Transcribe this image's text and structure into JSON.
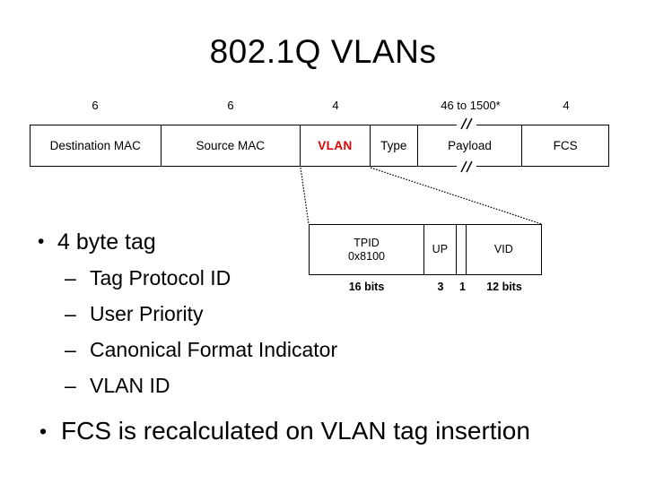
{
  "slide": {
    "title": "802.1Q VLANs"
  },
  "frame": {
    "name": "ethernet-frame",
    "cells": [
      {
        "label": "Destination MAC",
        "size": "6",
        "accent": false
      },
      {
        "label": "Source MAC",
        "size": "6",
        "accent": false
      },
      {
        "label": "VLAN",
        "size": "4",
        "accent": true
      },
      {
        "label": "Type",
        "size": "",
        "accent": false
      },
      {
        "label": "Payload",
        "size": "46 to 1500*",
        "accent": false
      },
      {
        "label": "FCS",
        "size": "4",
        "accent": false
      }
    ]
  },
  "tag": {
    "name": "vlan-tag-detail",
    "cells": [
      {
        "label": "TPID",
        "value": "0x8100",
        "bits": "16 bits"
      },
      {
        "label": "UP",
        "value": "",
        "bits": "3"
      },
      {
        "label": "",
        "value": "",
        "bits": "1"
      },
      {
        "label": "VID",
        "value": "",
        "bits": "12 bits"
      }
    ]
  },
  "bullets": {
    "primary": "4 byte tag",
    "sub_items": [
      "Tag Protocol ID",
      "User Priority",
      "Canonical Format Indicator",
      "VLAN ID"
    ],
    "final": "FCS is recalculated on VLAN tag insertion",
    "bullet_glyph": "•",
    "dash_glyph": "–"
  },
  "colors": {
    "accent_red": "#e00000",
    "text": "#000000",
    "background": "#ffffff",
    "border": "#000000"
  }
}
